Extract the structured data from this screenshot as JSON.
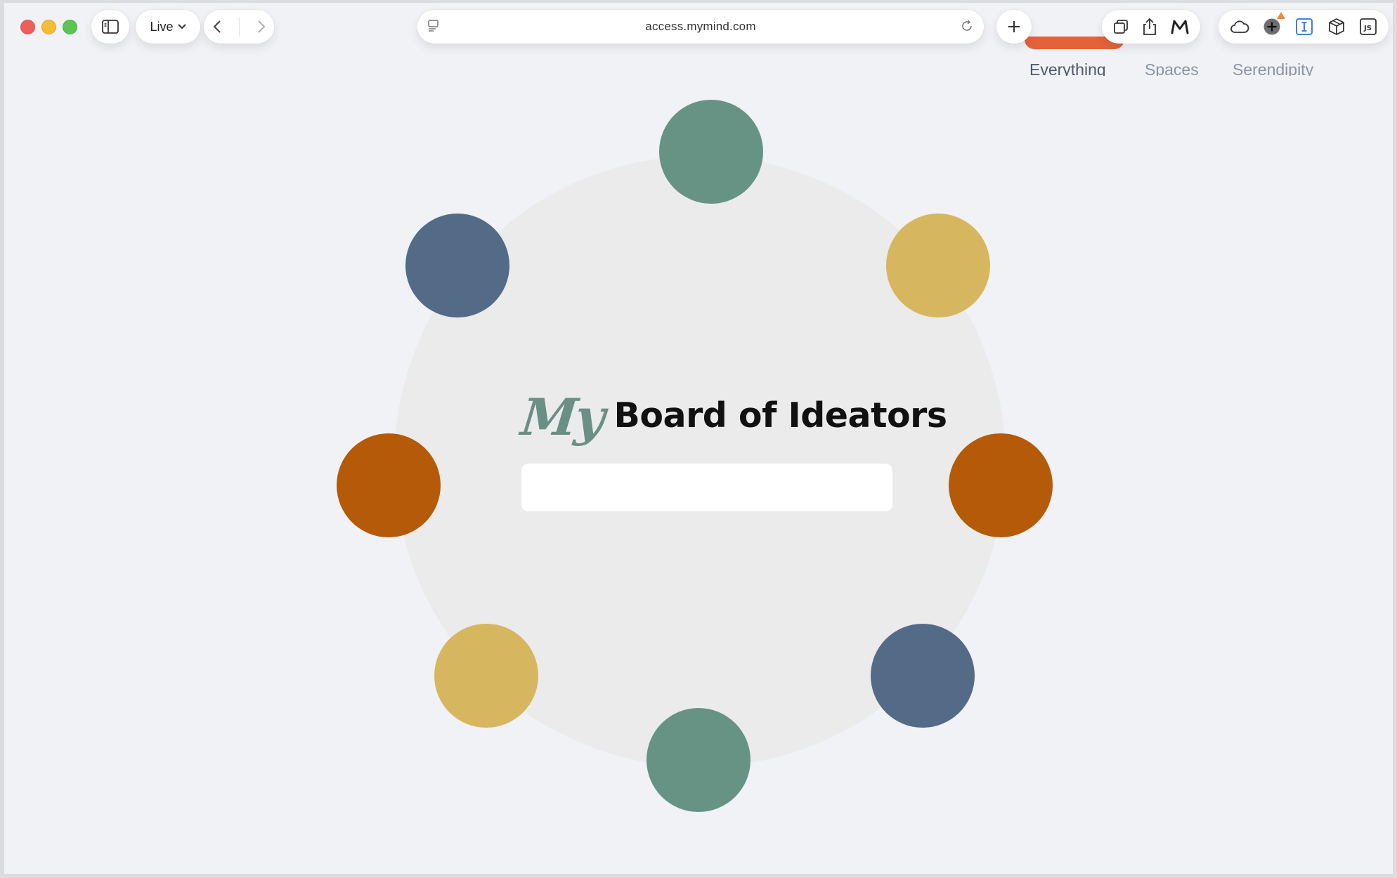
{
  "browser": {
    "mode_label": "Live",
    "url": "access.mymind.com",
    "extension_badge_color": "#f0883e",
    "toolbar_icons": [
      "sidebar-icon",
      "chevron-down-icon",
      "back-icon",
      "forward-icon",
      "site-info-icon",
      "reload-icon",
      "plus-icon",
      "tabs-overview-icon",
      "share-icon",
      "mymind-icon",
      "cloud-icon",
      "add-extension-icon",
      "instapaper-icon",
      "box-icon",
      "js-icon"
    ]
  },
  "page": {
    "nav": {
      "items": [
        "Everything",
        "Spaces",
        "Serendipity"
      ],
      "active_index": 0,
      "accent_color": "#e4623a"
    },
    "title": {
      "prefix": "My",
      "text": "Board of Ideators"
    },
    "input": {
      "value": "",
      "placeholder": ""
    },
    "circle_colors": {
      "green": "#669384",
      "blue": "#546b87",
      "yellow": "#d7b660",
      "orange": "#b55a09"
    }
  }
}
